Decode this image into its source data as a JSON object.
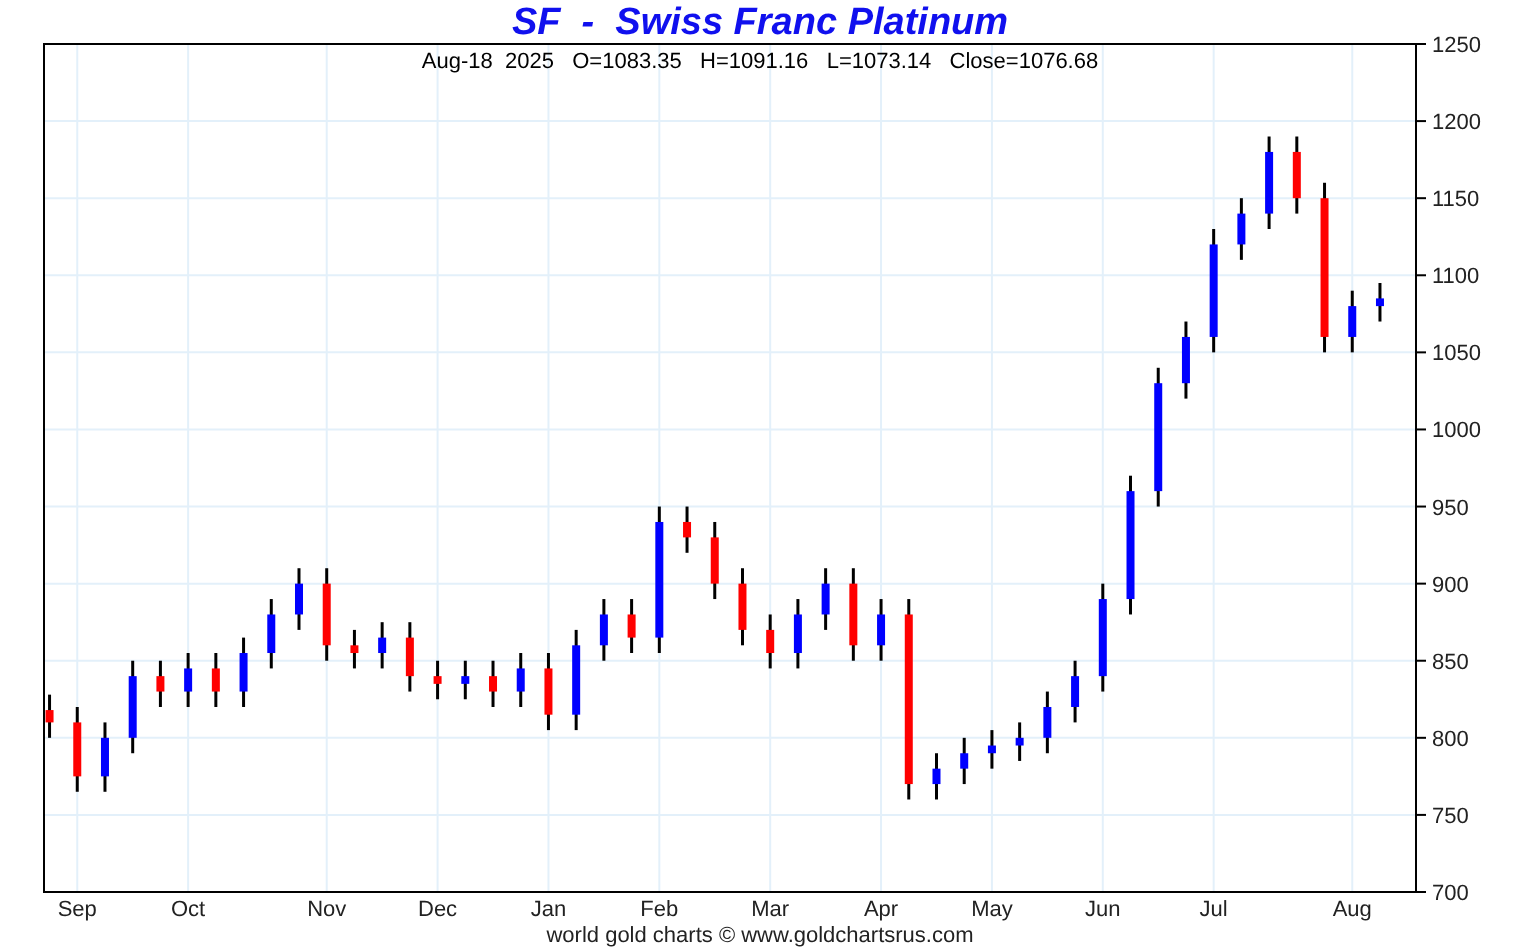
{
  "title": "SF  -  Swiss Franc Platinum",
  "quote": "Aug-18  2025   O=1083.35   H=1091.16   L=1073.14   Close=1076.68",
  "chart": {
    "chart_data": {
      "type": "candlestick",
      "grid": true,
      "ylim": [
        700,
        1250
      ],
      "yticks": [
        700,
        750,
        800,
        850,
        900,
        950,
        1000,
        1050,
        1100,
        1150,
        1200,
        1250
      ],
      "categories": [
        null,
        "Sep",
        null,
        null,
        null,
        "Oct",
        null,
        null,
        null,
        null,
        "Nov",
        null,
        null,
        null,
        "Dec",
        null,
        null,
        null,
        "Jan",
        null,
        null,
        null,
        "Feb",
        null,
        null,
        null,
        "Mar",
        null,
        null,
        null,
        "Apr",
        null,
        null,
        null,
        "May",
        null,
        null,
        null,
        "Jun",
        null,
        null,
        null,
        "Jul",
        null,
        null,
        null,
        null,
        "Aug",
        null
      ],
      "ohlc": [
        [
          818,
          828,
          800,
          810
        ],
        [
          810,
          820,
          765,
          775
        ],
        [
          775,
          810,
          765,
          800
        ],
        [
          800,
          850,
          790,
          840
        ],
        [
          840,
          850,
          820,
          830
        ],
        [
          830,
          855,
          820,
          845
        ],
        [
          845,
          855,
          820,
          830
        ],
        [
          830,
          865,
          820,
          855
        ],
        [
          855,
          890,
          845,
          880
        ],
        [
          880,
          910,
          870,
          900
        ],
        [
          900,
          910,
          850,
          860
        ],
        [
          860,
          870,
          845,
          855
        ],
        [
          855,
          875,
          845,
          865
        ],
        [
          865,
          875,
          830,
          840
        ],
        [
          840,
          850,
          825,
          835
        ],
        [
          835,
          850,
          825,
          840
        ],
        [
          840,
          850,
          820,
          830
        ],
        [
          830,
          855,
          820,
          845
        ],
        [
          845,
          855,
          805,
          815
        ],
        [
          815,
          870,
          805,
          860
        ],
        [
          860,
          890,
          850,
          880
        ],
        [
          880,
          890,
          855,
          865
        ],
        [
          865,
          950,
          855,
          940
        ],
        [
          940,
          950,
          920,
          930
        ],
        [
          930,
          940,
          890,
          900
        ],
        [
          900,
          910,
          860,
          870
        ],
        [
          870,
          880,
          845,
          855
        ],
        [
          855,
          890,
          845,
          880
        ],
        [
          880,
          910,
          870,
          900
        ],
        [
          900,
          910,
          850,
          860
        ],
        [
          860,
          890,
          850,
          880
        ],
        [
          880,
          890,
          760,
          770
        ],
        [
          770,
          790,
          760,
          780
        ],
        [
          780,
          800,
          770,
          790
        ],
        [
          790,
          805,
          780,
          795
        ],
        [
          795,
          810,
          785,
          800
        ],
        [
          800,
          830,
          790,
          820
        ],
        [
          820,
          850,
          810,
          840
        ],
        [
          840,
          900,
          830,
          890
        ],
        [
          890,
          970,
          880,
          960
        ],
        [
          960,
          1040,
          950,
          1030
        ],
        [
          1030,
          1070,
          1020,
          1060
        ],
        [
          1060,
          1130,
          1050,
          1120
        ],
        [
          1120,
          1150,
          1110,
          1140
        ],
        [
          1140,
          1190,
          1130,
          1180
        ],
        [
          1180,
          1190,
          1140,
          1150
        ],
        [
          1150,
          1160,
          1050,
          1060
        ],
        [
          1060,
          1090,
          1050,
          1080
        ],
        [
          1080,
          1095,
          1070,
          1085
        ]
      ]
    }
  },
  "footer": "world gold charts © www.goldchartsrus.com"
}
